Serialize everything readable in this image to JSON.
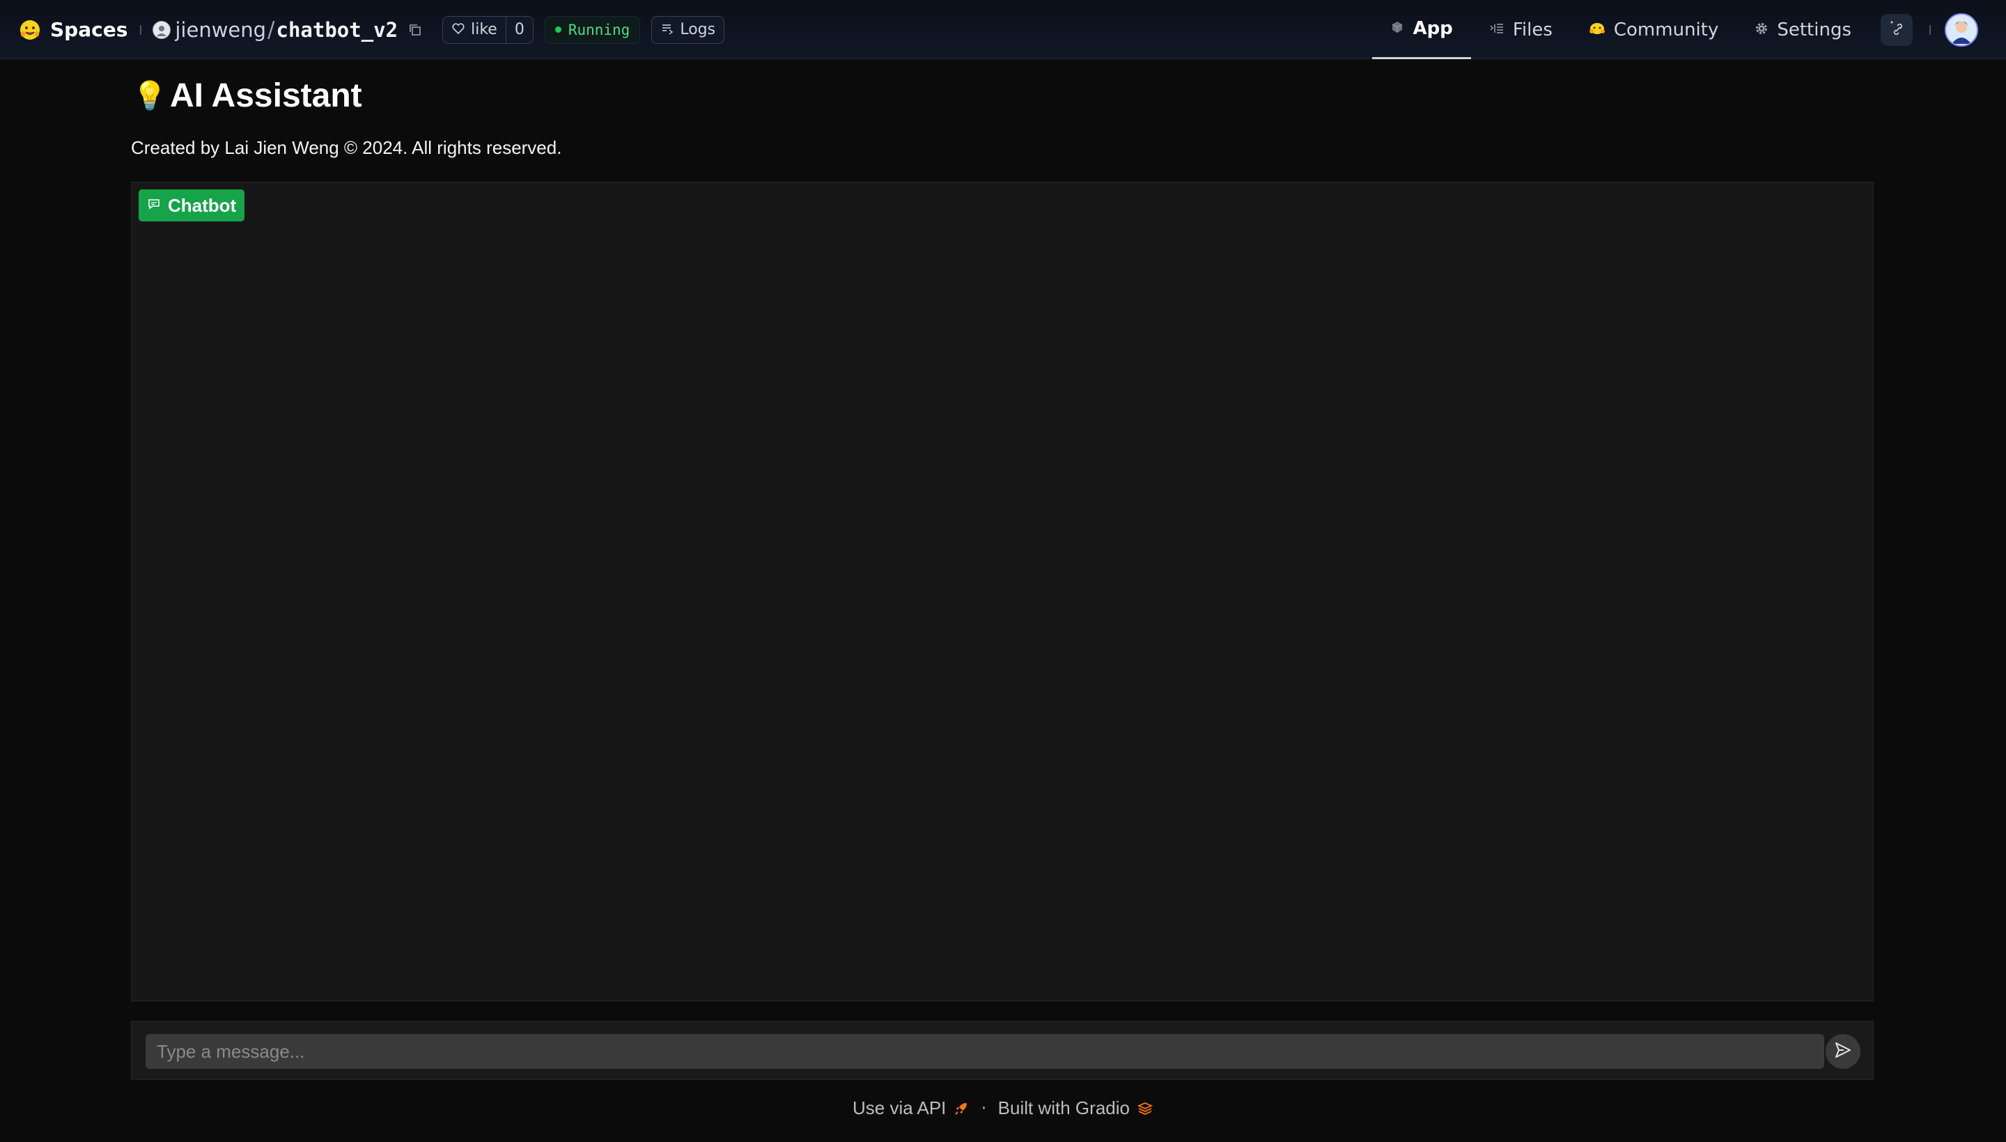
{
  "header": {
    "brand": "Spaces",
    "owner": "jienweng",
    "slash": "/",
    "repo": "chatbot_v2",
    "like_label": "like",
    "like_count": "0",
    "status": "Running",
    "logs_label": "Logs",
    "nav": [
      {
        "label": "App",
        "icon": "cube-icon",
        "active": true
      },
      {
        "label": "Files",
        "icon": "files-icon",
        "active": false
      },
      {
        "label": "Community",
        "icon": "community-icon",
        "active": false
      },
      {
        "label": "Settings",
        "icon": "gear-icon",
        "active": false
      }
    ]
  },
  "app": {
    "title_emoji": "💡",
    "title": "AI Assistant",
    "subtitle": "Created by Lai Jien Weng © 2024. All rights reserved.",
    "chatbot_label": "Chatbot",
    "input_placeholder": "Type a message...",
    "input_value": ""
  },
  "footer": {
    "api_label": "Use via API",
    "separator": "·",
    "built_label": "Built with Gradio"
  },
  "colors": {
    "accent_green": "#16a34a",
    "running_green": "#4ade80",
    "background": "#0b0b0b",
    "panel": "#171717"
  }
}
